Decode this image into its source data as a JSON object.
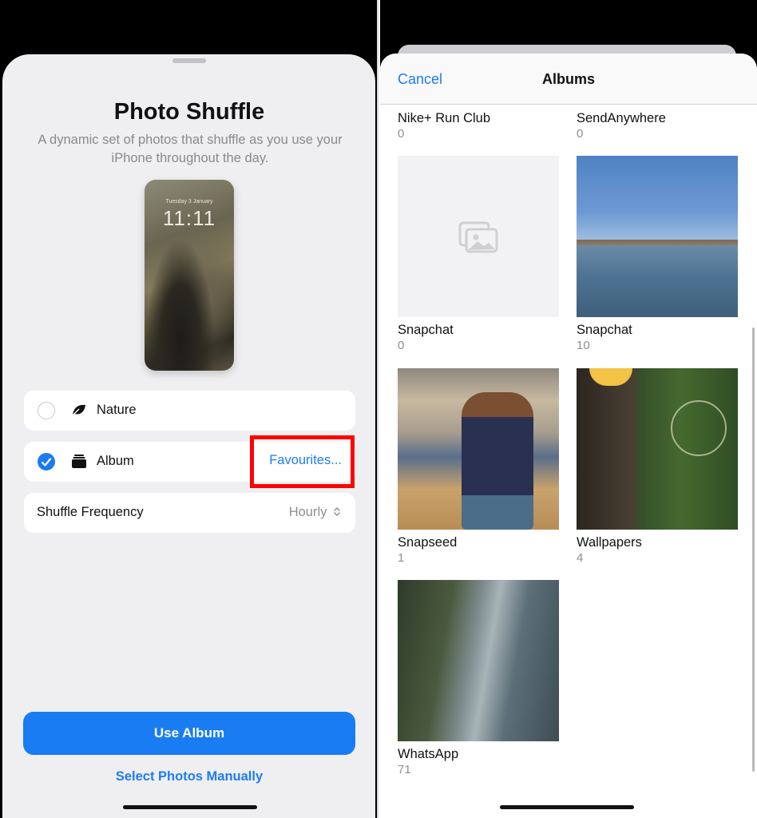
{
  "left_screen": {
    "title": "Photo Shuffle",
    "subtitle": "A dynamic set of photos that shuffle as you use your iPhone throughout the day.",
    "preview": {
      "date": "Tuesday 3 January",
      "time": "11:11"
    },
    "options": [
      {
        "label": "Nature",
        "selected": false,
        "icon": "leaf-icon"
      },
      {
        "label": "Album",
        "selected": true,
        "icon": "album-stack-icon",
        "value": "Favourites..."
      }
    ],
    "shuffle_frequency": {
      "label": "Shuffle Frequency",
      "value": "Hourly"
    },
    "use_button": "Use Album",
    "manual_link": "Select Photos Manually",
    "highlight_color": "#ff0000",
    "accent_color": "#1a7cf2"
  },
  "right_screen": {
    "nav": {
      "cancel": "Cancel",
      "title": "Albums"
    },
    "albums": [
      {
        "name": "Nike+ Run Club",
        "count": "0"
      },
      {
        "name": "SendAnywhere",
        "count": "0"
      },
      {
        "name": "Snapchat",
        "count": "0"
      },
      {
        "name": "Snapchat",
        "count": "10"
      },
      {
        "name": "Snapseed",
        "count": "1"
      },
      {
        "name": "Wallpapers",
        "count": "4"
      },
      {
        "name": "WhatsApp",
        "count": "71"
      }
    ]
  }
}
